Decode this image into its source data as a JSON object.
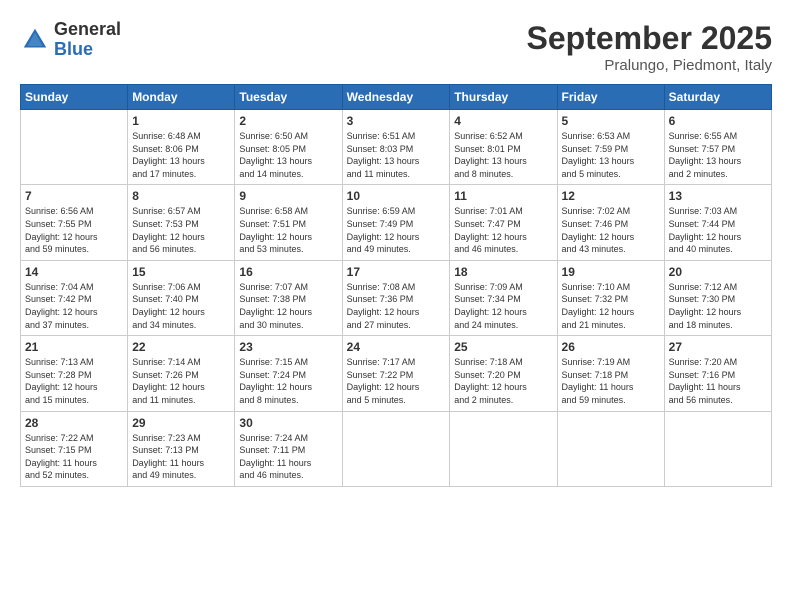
{
  "header": {
    "logo_general": "General",
    "logo_blue": "Blue",
    "month_title": "September 2025",
    "location": "Pralungo, Piedmont, Italy"
  },
  "days_of_week": [
    "Sunday",
    "Monday",
    "Tuesday",
    "Wednesday",
    "Thursday",
    "Friday",
    "Saturday"
  ],
  "weeks": [
    [
      {
        "day": "",
        "info": ""
      },
      {
        "day": "1",
        "info": "Sunrise: 6:48 AM\nSunset: 8:06 PM\nDaylight: 13 hours\nand 17 minutes."
      },
      {
        "day": "2",
        "info": "Sunrise: 6:50 AM\nSunset: 8:05 PM\nDaylight: 13 hours\nand 14 minutes."
      },
      {
        "day": "3",
        "info": "Sunrise: 6:51 AM\nSunset: 8:03 PM\nDaylight: 13 hours\nand 11 minutes."
      },
      {
        "day": "4",
        "info": "Sunrise: 6:52 AM\nSunset: 8:01 PM\nDaylight: 13 hours\nand 8 minutes."
      },
      {
        "day": "5",
        "info": "Sunrise: 6:53 AM\nSunset: 7:59 PM\nDaylight: 13 hours\nand 5 minutes."
      },
      {
        "day": "6",
        "info": "Sunrise: 6:55 AM\nSunset: 7:57 PM\nDaylight: 13 hours\nand 2 minutes."
      }
    ],
    [
      {
        "day": "7",
        "info": "Sunrise: 6:56 AM\nSunset: 7:55 PM\nDaylight: 12 hours\nand 59 minutes."
      },
      {
        "day": "8",
        "info": "Sunrise: 6:57 AM\nSunset: 7:53 PM\nDaylight: 12 hours\nand 56 minutes."
      },
      {
        "day": "9",
        "info": "Sunrise: 6:58 AM\nSunset: 7:51 PM\nDaylight: 12 hours\nand 53 minutes."
      },
      {
        "day": "10",
        "info": "Sunrise: 6:59 AM\nSunset: 7:49 PM\nDaylight: 12 hours\nand 49 minutes."
      },
      {
        "day": "11",
        "info": "Sunrise: 7:01 AM\nSunset: 7:47 PM\nDaylight: 12 hours\nand 46 minutes."
      },
      {
        "day": "12",
        "info": "Sunrise: 7:02 AM\nSunset: 7:46 PM\nDaylight: 12 hours\nand 43 minutes."
      },
      {
        "day": "13",
        "info": "Sunrise: 7:03 AM\nSunset: 7:44 PM\nDaylight: 12 hours\nand 40 minutes."
      }
    ],
    [
      {
        "day": "14",
        "info": "Sunrise: 7:04 AM\nSunset: 7:42 PM\nDaylight: 12 hours\nand 37 minutes."
      },
      {
        "day": "15",
        "info": "Sunrise: 7:06 AM\nSunset: 7:40 PM\nDaylight: 12 hours\nand 34 minutes."
      },
      {
        "day": "16",
        "info": "Sunrise: 7:07 AM\nSunset: 7:38 PM\nDaylight: 12 hours\nand 30 minutes."
      },
      {
        "day": "17",
        "info": "Sunrise: 7:08 AM\nSunset: 7:36 PM\nDaylight: 12 hours\nand 27 minutes."
      },
      {
        "day": "18",
        "info": "Sunrise: 7:09 AM\nSunset: 7:34 PM\nDaylight: 12 hours\nand 24 minutes."
      },
      {
        "day": "19",
        "info": "Sunrise: 7:10 AM\nSunset: 7:32 PM\nDaylight: 12 hours\nand 21 minutes."
      },
      {
        "day": "20",
        "info": "Sunrise: 7:12 AM\nSunset: 7:30 PM\nDaylight: 12 hours\nand 18 minutes."
      }
    ],
    [
      {
        "day": "21",
        "info": "Sunrise: 7:13 AM\nSunset: 7:28 PM\nDaylight: 12 hours\nand 15 minutes."
      },
      {
        "day": "22",
        "info": "Sunrise: 7:14 AM\nSunset: 7:26 PM\nDaylight: 12 hours\nand 11 minutes."
      },
      {
        "day": "23",
        "info": "Sunrise: 7:15 AM\nSunset: 7:24 PM\nDaylight: 12 hours\nand 8 minutes."
      },
      {
        "day": "24",
        "info": "Sunrise: 7:17 AM\nSunset: 7:22 PM\nDaylight: 12 hours\nand 5 minutes."
      },
      {
        "day": "25",
        "info": "Sunrise: 7:18 AM\nSunset: 7:20 PM\nDaylight: 12 hours\nand 2 minutes."
      },
      {
        "day": "26",
        "info": "Sunrise: 7:19 AM\nSunset: 7:18 PM\nDaylight: 11 hours\nand 59 minutes."
      },
      {
        "day": "27",
        "info": "Sunrise: 7:20 AM\nSunset: 7:16 PM\nDaylight: 11 hours\nand 56 minutes."
      }
    ],
    [
      {
        "day": "28",
        "info": "Sunrise: 7:22 AM\nSunset: 7:15 PM\nDaylight: 11 hours\nand 52 minutes."
      },
      {
        "day": "29",
        "info": "Sunrise: 7:23 AM\nSunset: 7:13 PM\nDaylight: 11 hours\nand 49 minutes."
      },
      {
        "day": "30",
        "info": "Sunrise: 7:24 AM\nSunset: 7:11 PM\nDaylight: 11 hours\nand 46 minutes."
      },
      {
        "day": "",
        "info": ""
      },
      {
        "day": "",
        "info": ""
      },
      {
        "day": "",
        "info": ""
      },
      {
        "day": "",
        "info": ""
      }
    ]
  ]
}
